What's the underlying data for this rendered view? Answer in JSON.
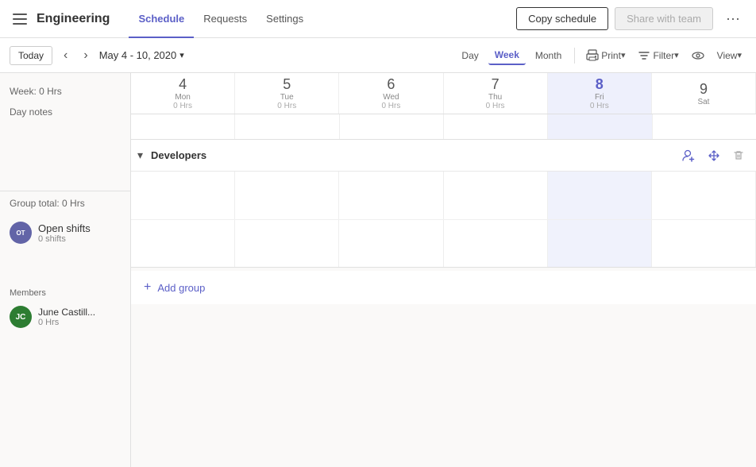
{
  "topbar": {
    "app_title": "Engineering",
    "nav_tabs": [
      {
        "id": "schedule",
        "label": "Schedule",
        "active": true
      },
      {
        "id": "requests",
        "label": "Requests",
        "active": false
      },
      {
        "id": "settings",
        "label": "Settings",
        "active": false
      }
    ],
    "btn_copy_schedule": "Copy schedule",
    "btn_share_team": "Share with team",
    "btn_more_icon": "···"
  },
  "toolbar2": {
    "btn_today": "Today",
    "date_range": "May 4 - 10, 2020",
    "views": [
      "Day",
      "Week",
      "Month"
    ],
    "active_view": "Week",
    "btn_print": "Print",
    "btn_filter": "Filter",
    "btn_view": "View"
  },
  "sidebar": {
    "week_hours": "Week: 0 Hrs",
    "day_notes": "Day notes",
    "group_total": "Group total: 0 Hrs",
    "open_shifts": {
      "initials": "OT",
      "name": "Open shifts",
      "shifts": "0 shifts"
    },
    "members_label": "Members",
    "members": [
      {
        "initials": "JC",
        "name": "June Castill...",
        "hours": "0 Hrs"
      }
    ]
  },
  "calendar": {
    "days": [
      {
        "num": "4",
        "name": "Mon",
        "hrs": "0 Hrs",
        "today": false
      },
      {
        "num": "5",
        "name": "Tue",
        "hrs": "0 Hrs",
        "today": false
      },
      {
        "num": "6",
        "name": "Wed",
        "hrs": "0 Hrs",
        "today": false
      },
      {
        "num": "7",
        "name": "Thu",
        "hrs": "0 Hrs",
        "today": false
      },
      {
        "num": "8",
        "name": "Fri",
        "hrs": "0 Hrs",
        "today": true
      },
      {
        "num": "9",
        "name": "Sat",
        "hrs": "",
        "today": false
      }
    ],
    "groups": [
      {
        "name": "Developers",
        "actions": [
          "add-member",
          "move",
          "delete"
        ]
      }
    ],
    "add_group_label": "Add group"
  }
}
